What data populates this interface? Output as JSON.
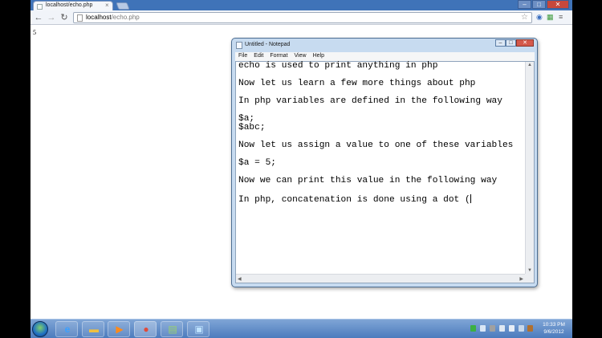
{
  "browser": {
    "tab_title": "localhost/echo.php",
    "tab_close": "×",
    "url_host": "localhost",
    "url_path": "/echo.php",
    "back_glyph": "←",
    "forward_glyph": "→",
    "reload_glyph": "↻",
    "star_glyph": "☆",
    "menu_glyph": "≡"
  },
  "page": {
    "output": "5"
  },
  "notepad": {
    "title": "Untitled - Notepad",
    "menus": [
      "File",
      "Edit",
      "Format",
      "View",
      "Help"
    ],
    "lines": [
      "echo is used to print anything in php",
      "",
      "Now let us learn a few more things about php",
      "",
      "In php variables are defined in the following way",
      "",
      "$a;",
      "$abc;",
      "",
      "Now let us assign a value to one of these variables",
      "",
      "$a = 5;",
      "",
      "Now we can print this value in the following way",
      "",
      "In php, concatenation is done using a dot ("
    ]
  },
  "taskbar": {
    "clock_time": "10:33 PM",
    "clock_date": "9/6/2012"
  },
  "colors": {
    "titlebar_blue": "#3f73b8",
    "taskbar_blue": "#4c7bbd",
    "close_red": "#d5594b"
  }
}
